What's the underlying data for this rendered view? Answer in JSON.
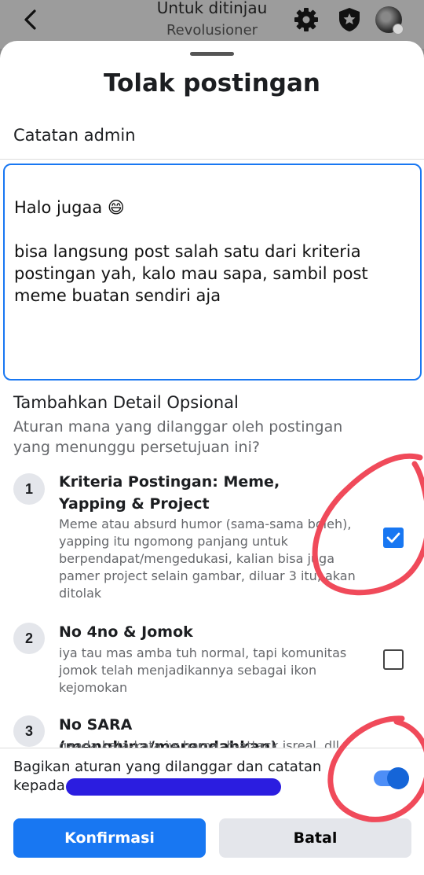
{
  "header": {
    "title": "Untuk ditinjau",
    "subtitle": "Revolusioner",
    "icons": [
      "back-arrow-icon",
      "gear-icon",
      "shield-star-icon",
      "avatar"
    ]
  },
  "sheet": {
    "title": "Tolak postingan",
    "note_label": "Catatan admin",
    "note_value": "Halo jugaa 😄\n\nbisa langsung post salah satu dari kriteria postingan yah, kalo mau sapa, sambil post meme buatan sendiri aja",
    "optional_title": "Tambahkan Detail Opsional",
    "optional_desc": "Aturan mana yang dilanggar oleh postingan yang menunggu persetujuan ini?",
    "rules": [
      {
        "num": "1",
        "title": "Kriteria Postingan: Meme, Yapping & Project",
        "desc": "Meme atau absurd humor (sama-sama boleh), yapping itu ngomong panjang untuk berpendapat/mengedukasi, kalian bisa juga pamer project selain gambar, diluar 3 itu, akan ditolak",
        "checked": true
      },
      {
        "num": "2",
        "title": "No 4no & Jomok",
        "desc": "iya tau mas amba tuh normal, tapi komunitas jomok telah menjadikannya sebagai ikon kejomokan",
        "checked": false
      },
      {
        "num": "3",
        "title": "No SARA (menghina/merendahkan)",
        "desc": "gaada kata-kata jw hama, b-attack isreal, dll",
        "checked": false
      }
    ],
    "share_text": "Bagikan aturan yang dilanggar dan catatan kepada",
    "share_toggle_on": true,
    "confirm_label": "Konfirmasi",
    "cancel_label": "Batal"
  },
  "colors": {
    "accent": "#1877f2",
    "annotation": "#f04a5a"
  }
}
